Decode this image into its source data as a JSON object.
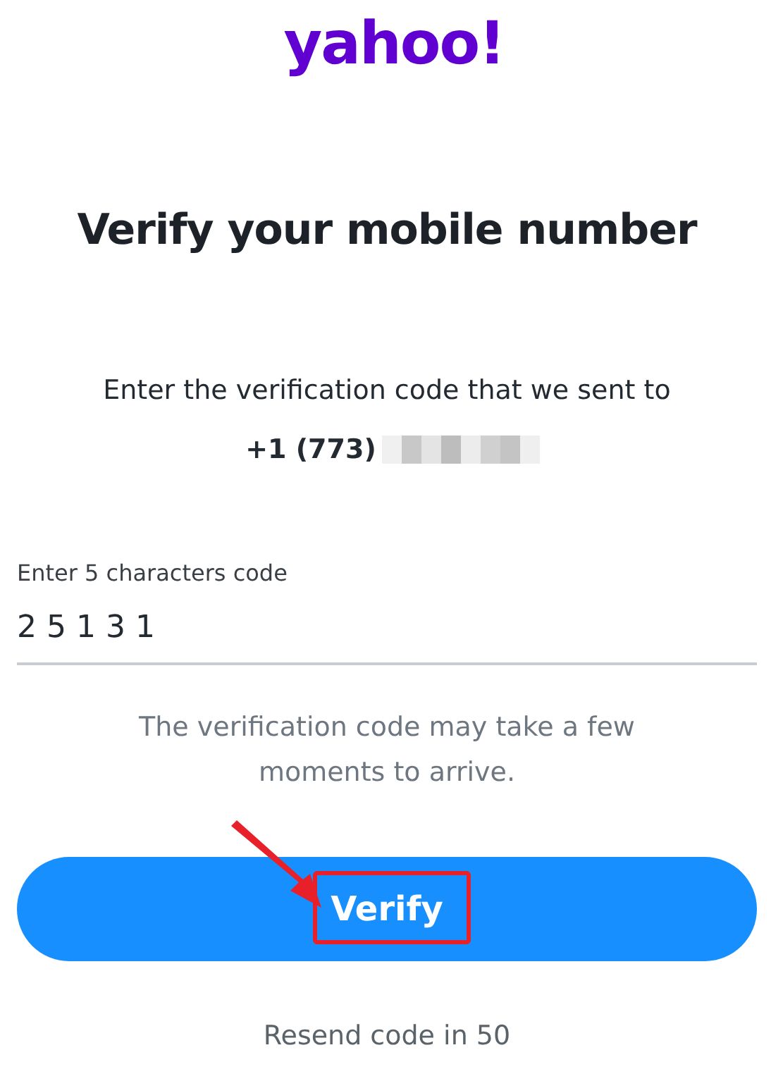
{
  "logo": "yahoo!",
  "title": "Verify your mobile number",
  "instruction": "Enter the verification code that we sent to",
  "phone": "+1 (773)",
  "code_field": {
    "label": "Enter 5 characters code",
    "value": "2 5 1 3 1"
  },
  "hint": "The verification code may take a few moments to arrive.",
  "verify_button": {
    "label": "Verify",
    "arrow": true,
    "highlighted": true
  },
  "resend": "Resend code in 50"
}
